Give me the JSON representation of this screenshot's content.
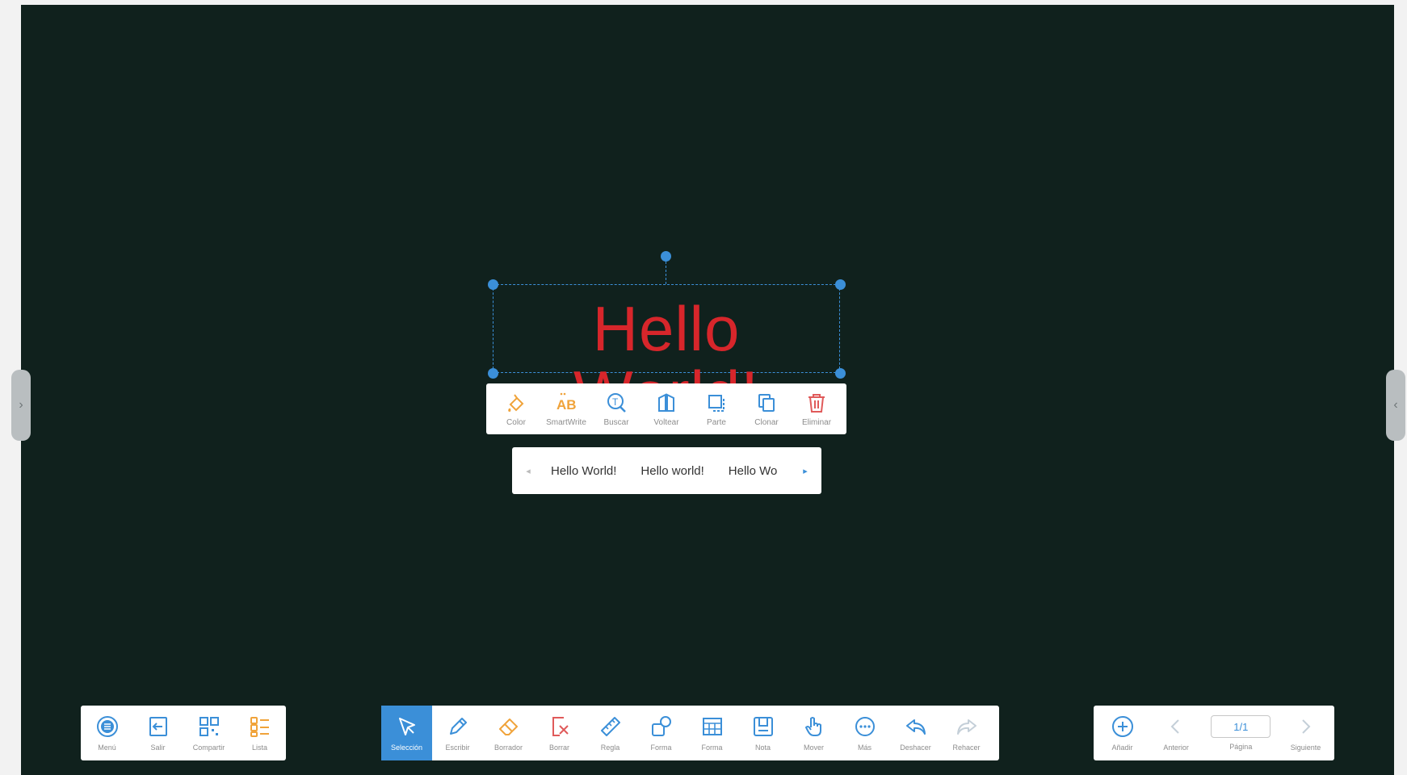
{
  "colors": {
    "board": "#10211d",
    "accent": "#3b8fd8",
    "text_object": "#d7262b",
    "orange": "#f0a33a",
    "red": "#e05a5a"
  },
  "canvas": {
    "text_object": "Hello World!"
  },
  "context_menu": {
    "items": [
      {
        "label": "Color",
        "icon": "color-fill-icon"
      },
      {
        "label": "SmartWrite",
        "icon": "smartwrite-icon"
      },
      {
        "label": "Buscar",
        "icon": "search-icon"
      },
      {
        "label": "Voltear",
        "icon": "flip-icon"
      },
      {
        "label": "Parte",
        "icon": "part-icon"
      },
      {
        "label": "Clonar",
        "icon": "clone-icon"
      },
      {
        "label": "Eliminar",
        "icon": "trash-icon"
      }
    ]
  },
  "suggestions": {
    "items": [
      "Hello World!",
      "Hello world!",
      "Hello Wo"
    ]
  },
  "left_toolbar": {
    "items": [
      {
        "label": "Menú",
        "icon": "menu-icon"
      },
      {
        "label": "Salir",
        "icon": "exit-icon"
      },
      {
        "label": "Compartir",
        "icon": "qr-share-icon"
      },
      {
        "label": "Lista",
        "icon": "list-icon"
      }
    ]
  },
  "main_toolbar": {
    "items": [
      {
        "label": "Selección",
        "icon": "select-cursor-icon",
        "active": true
      },
      {
        "label": "Escribir",
        "icon": "pen-icon"
      },
      {
        "label": "Borrador",
        "icon": "eraser-icon"
      },
      {
        "label": "Borrar",
        "icon": "clear-icon"
      },
      {
        "label": "Regla",
        "icon": "ruler-icon"
      },
      {
        "label": "Forma",
        "icon": "shapes-icon"
      },
      {
        "label": "Forma",
        "icon": "table-icon"
      },
      {
        "label": "Nota",
        "icon": "note-icon"
      },
      {
        "label": "Mover",
        "icon": "hand-move-icon"
      },
      {
        "label": "Más",
        "icon": "more-icon"
      },
      {
        "label": "Deshacer",
        "icon": "undo-icon"
      },
      {
        "label": "Rehacer",
        "icon": "redo-icon"
      }
    ]
  },
  "right_toolbar": {
    "add_label": "Añadir",
    "prev_label": "Anterior",
    "page_value": "1/1",
    "page_label": "Página",
    "next_label": "Siguiente"
  }
}
